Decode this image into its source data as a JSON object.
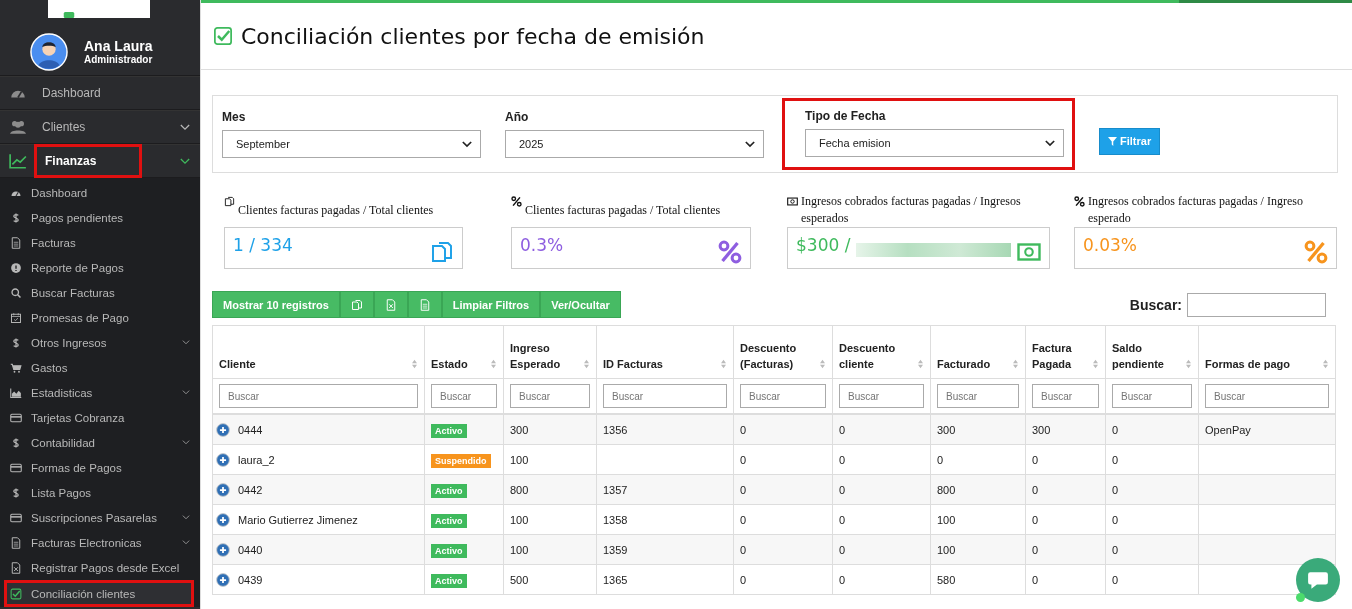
{
  "sidebar": {
    "user": {
      "name": "Ana Laura",
      "role": "Administrador"
    },
    "items": [
      {
        "label": "Dashboard",
        "expanded": false,
        "has_submenu": false,
        "highlighted": false
      },
      {
        "label": "Clientes",
        "expanded": false,
        "has_submenu": true,
        "highlighted": false
      },
      {
        "label": "Finanzas",
        "expanded": true,
        "has_submenu": true,
        "highlighted": true,
        "children": [
          {
            "label": "Dashboard",
            "has_submenu": false,
            "selected": false,
            "highlighted": false
          },
          {
            "label": "Pagos pendientes",
            "has_submenu": false,
            "selected": false,
            "highlighted": false
          },
          {
            "label": "Facturas",
            "has_submenu": false,
            "selected": false,
            "highlighted": false
          },
          {
            "label": "Reporte de Pagos",
            "has_submenu": false,
            "selected": false,
            "highlighted": false
          },
          {
            "label": "Buscar Facturas",
            "has_submenu": false,
            "selected": false,
            "highlighted": false
          },
          {
            "label": "Promesas de Pago",
            "has_submenu": false,
            "selected": false,
            "highlighted": false
          },
          {
            "label": "Otros Ingresos",
            "has_submenu": true,
            "selected": false,
            "highlighted": false
          },
          {
            "label": "Gastos",
            "has_submenu": false,
            "selected": false,
            "highlighted": false
          },
          {
            "label": "Estadisticas",
            "has_submenu": true,
            "selected": false,
            "highlighted": false
          },
          {
            "label": "Tarjetas Cobranza",
            "has_submenu": false,
            "selected": false,
            "highlighted": false
          },
          {
            "label": "Contabilidad",
            "has_submenu": true,
            "selected": false,
            "highlighted": false
          },
          {
            "label": "Formas de Pagos",
            "has_submenu": false,
            "selected": false,
            "highlighted": false
          },
          {
            "label": "Lista Pagos",
            "has_submenu": false,
            "selected": false,
            "highlighted": false
          },
          {
            "label": "Suscripciones Pasarelas",
            "has_submenu": true,
            "selected": false,
            "highlighted": false
          },
          {
            "label": "Facturas Electronicas",
            "has_submenu": true,
            "selected": false,
            "highlighted": false
          },
          {
            "label": "Registrar Pagos desde Excel",
            "has_submenu": false,
            "selected": false,
            "highlighted": false
          },
          {
            "label": "Conciliación clientes",
            "has_submenu": false,
            "selected": true,
            "highlighted": true
          }
        ]
      }
    ]
  },
  "page": {
    "title": "Conciliación clientes por fecha de emisión"
  },
  "filters": {
    "fields": [
      {
        "label": "Mes",
        "value": "September"
      },
      {
        "label": "Año",
        "value": "2025"
      },
      {
        "label": "Tipo de Fecha",
        "value": "Fecha emision",
        "highlighted": true
      }
    ],
    "button": "Filtrar"
  },
  "stats": [
    {
      "title": "Clientes facturas pagadas / Total clientes",
      "value": "1 / 334",
      "color": "#1ea1e8"
    },
    {
      "title": "Clientes facturas pagadas / Total clientes",
      "value": "0.3%",
      "color": "#8e5ee0"
    },
    {
      "title": "Ingresos cobrados facturas pagadas / Ingresos esperados",
      "value": "$300 /",
      "color": "#3fba5d",
      "redacted": true
    },
    {
      "title": "Ingresos cobrados facturas pagadas / Ingreso esperado",
      "value": "0.03%",
      "color": "#f7941d"
    }
  ],
  "toolbar": [
    {
      "kind": "text",
      "label": "Mostrar 10 registros"
    },
    {
      "kind": "icon"
    },
    {
      "kind": "icon"
    },
    {
      "kind": "icon"
    },
    {
      "kind": "text",
      "label": "Limpiar Filtros"
    },
    {
      "kind": "text",
      "label": "Ver/Ocultar"
    }
  ],
  "search_label": "Buscar:",
  "table": {
    "columns": [
      {
        "label": "Cliente",
        "placeholder": "Buscar"
      },
      {
        "label": "Estado",
        "placeholder": "Buscar"
      },
      {
        "label": "Ingreso Esperado",
        "placeholder": "Buscar"
      },
      {
        "label": "ID Facturas",
        "placeholder": "Buscar"
      },
      {
        "label": "Descuento (Facturas)",
        "placeholder": "Buscar"
      },
      {
        "label": "Descuento cliente",
        "placeholder": "Buscar"
      },
      {
        "label": "Facturado",
        "placeholder": "Buscar"
      },
      {
        "label": "Factura Pagada",
        "placeholder": "Buscar"
      },
      {
        "label": "Saldo pendiente",
        "placeholder": "Buscar"
      },
      {
        "label": "Formas de pago",
        "placeholder": "Buscar"
      }
    ],
    "rows": [
      {
        "color": "#3fba5d",
        "cells": [
          "0444",
          "Activo",
          "300",
          "1356",
          "0",
          "0",
          "300",
          "300",
          "0",
          "OpenPay"
        ]
      },
      {
        "color": "#f7941d",
        "cells": [
          "laura_2",
          "Suspendido",
          "100",
          "",
          "0",
          "0",
          "0",
          "0",
          "0",
          ""
        ]
      },
      {
        "color": "#3fba5d",
        "cells": [
          "0442",
          "Activo",
          "800",
          "1357",
          "0",
          "0",
          "800",
          "0",
          "0",
          ""
        ]
      },
      {
        "color": "#3fba5d",
        "cells": [
          "Mario Gutierrez Jimenez",
          "Activo",
          "100",
          "1358",
          "0",
          "0",
          "100",
          "0",
          "0",
          ""
        ]
      },
      {
        "color": "#3fba5d",
        "cells": [
          "0440",
          "Activo",
          "100",
          "1359",
          "0",
          "0",
          "100",
          "0",
          "0",
          ""
        ]
      },
      {
        "color": "#3fba5d",
        "cells": [
          "0439",
          "Activo",
          "500",
          "1365",
          "0",
          "0",
          "580",
          "0",
          "0",
          ""
        ]
      }
    ]
  }
}
